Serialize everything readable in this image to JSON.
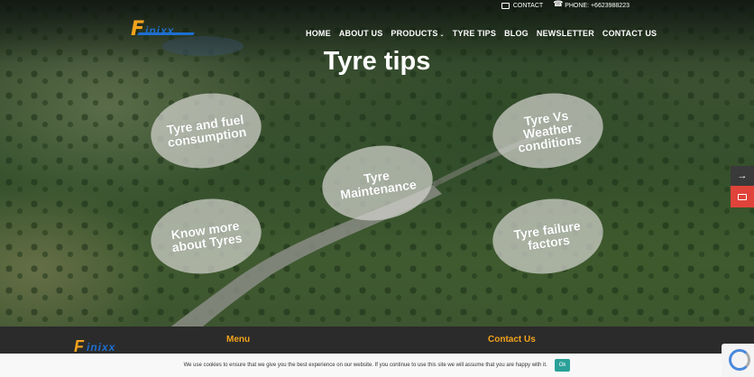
{
  "topbar": {
    "contact_label": "CONTACT",
    "phone_label": "PHONE: +6623988223"
  },
  "brand": {
    "logo_initial": "F",
    "logo_rest": "inixx"
  },
  "nav": {
    "items": [
      {
        "label": "HOME"
      },
      {
        "label": "ABOUT US"
      },
      {
        "label": "PRODUCTS"
      },
      {
        "label": "TYRE TIPS"
      },
      {
        "label": "BLOG"
      },
      {
        "label": "NEWSLETTER"
      },
      {
        "label": "CONTACT US"
      }
    ],
    "active": "TYRE TIPS"
  },
  "page": {
    "title": "Tyre tips"
  },
  "tips": [
    {
      "line1": "Tyre and fuel",
      "line2": "consumption",
      "line3": ""
    },
    {
      "line1": "Tyre Vs",
      "line2": "Weather",
      "line3": "conditions"
    },
    {
      "line1": "Tyre",
      "line2": "Maintenance",
      "line3": ""
    },
    {
      "line1": "Know more",
      "line2": "about Tyres",
      "line3": ""
    },
    {
      "line1": "Tyre failure",
      "line2": "factors",
      "line3": ""
    }
  ],
  "side": {
    "arrow": "→"
  },
  "footer": {
    "menu_title": "Menu",
    "contact_title": "Contact Us"
  },
  "cookie": {
    "message": "We use cookies to ensure that we give you the best experience on our website. If you continue to use this site we will assume that you are happy with it.",
    "ok_label": "Ok"
  },
  "colors": {
    "accent": "#f2a31c",
    "brand_blue": "#1d6fd0",
    "mail_red": "#e0433a",
    "ok_green": "#2aa198"
  }
}
